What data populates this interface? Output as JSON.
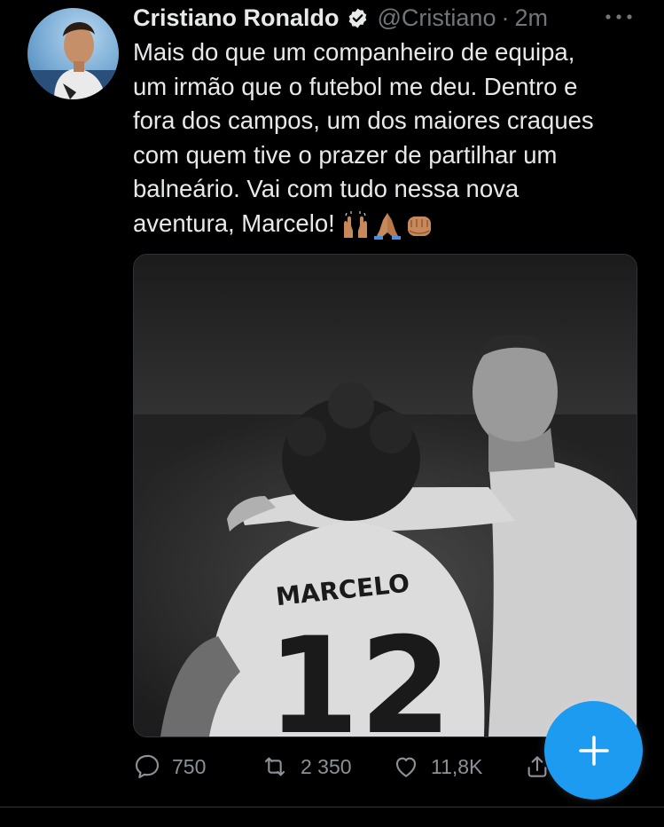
{
  "tweet": {
    "display_name": "Cristiano Ronaldo",
    "handle": "@Cristiano",
    "separator": "·",
    "time": "2m",
    "text": "Mais do que um companheiro de equipa,\num irmão que o futebol me deu. Dentro e\nfora dos campos, um dos maiores craques\ncom quem tive o prazer de partilhar um\nbalneário. Vai com tudo nessa nova\naventura, Marcelo!",
    "emojis": [
      "raising-hands-icon",
      "folded-hands-icon",
      "fist-bump-icon"
    ]
  },
  "media": {
    "jersey_name": "MARCELO",
    "jersey_number": "12"
  },
  "actions": {
    "replies": "750",
    "retweets": "2 350",
    "likes": "11,8K"
  },
  "colors": {
    "background": "#000000",
    "text": "#e7e9ea",
    "muted": "#71767b",
    "accent": "#1d9bf0",
    "verified": "#e7e9ea"
  }
}
